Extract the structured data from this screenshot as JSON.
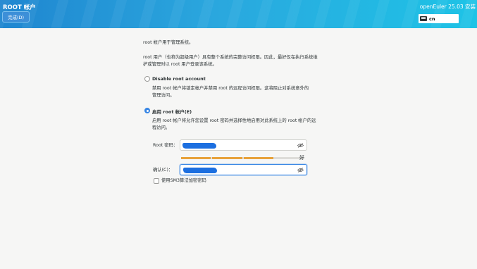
{
  "header": {
    "title": "ROOT 帐户",
    "done_button": "完成(D)",
    "product": "openEuler 25.03 安装",
    "keyboard_layout": "cn"
  },
  "content": {
    "intro": "root 帐户用于管理系统。",
    "desc_line1": "root 用户（也称为超级用户）具有整个系统的完整访问权限。因此，最好仅在执行系统维",
    "desc_line2": "护或管理时以 root 用户登录该系统。",
    "disable_option": {
      "label": "Disable root account",
      "desc_line1": "禁用 root 帐户将锁定帐户并禁用 root 的远程访问权限。这将阻止对系统意外的",
      "desc_line2": "管理访问。",
      "selected": false
    },
    "enable_option": {
      "label": "启用 root 帐户(E)",
      "desc_line1": "启用 root 帐户将允许您设置 root 密码并选择性地启用对此系统上的 root 帐户的远",
      "desc_line2": "程访问。",
      "selected": true
    },
    "password_label": "Root 密码：",
    "strength_label": "好",
    "strength_fraction": 0.75,
    "confirm_label": "确认(C)：",
    "sm3_checkbox_label": "使用SM3算法加密密码",
    "sm3_checked": false
  },
  "colors": {
    "accent": "#3584e4",
    "strength": "#e8a23b"
  }
}
